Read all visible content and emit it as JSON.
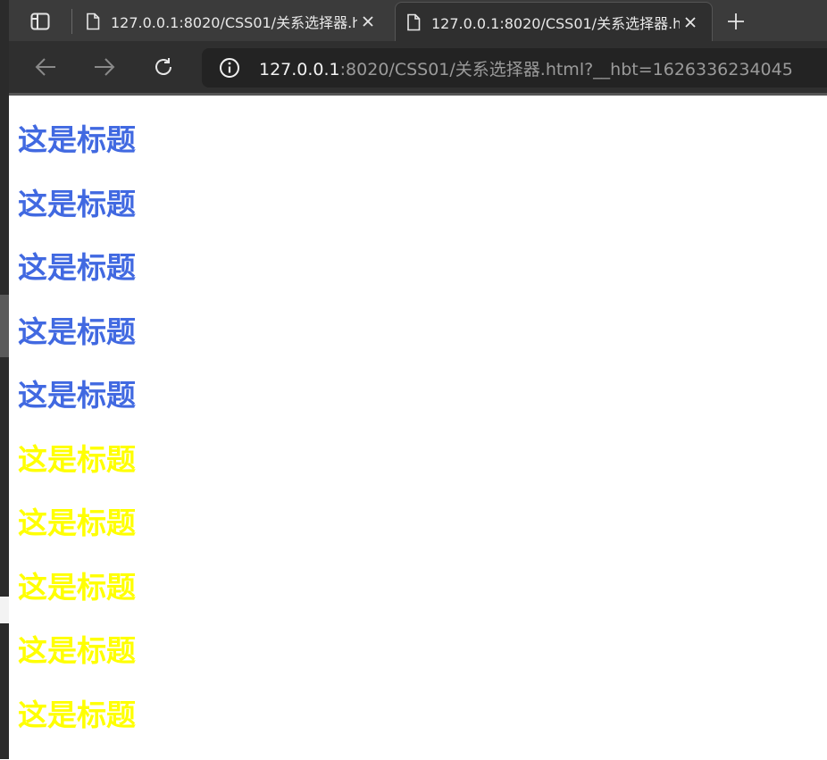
{
  "browser": {
    "tabs": [
      {
        "title": "127.0.0.1:8020/CSS01/关系选择器.html?__hbt=1626336234045",
        "active": false
      },
      {
        "title": "127.0.0.1:8020/CSS01/关系选择器.html?__hbt=1626336234045",
        "active": true
      }
    ],
    "address": {
      "host": "127.0.0.1",
      "path": ":8020/CSS01/关系选择器.html?__hbt=1626336234045"
    },
    "icons": {
      "tab_actions": "tab-actions-icon",
      "page": "page-icon",
      "close": "close-icon",
      "new_tab": "plus-icon",
      "back": "back-arrow-icon",
      "forward": "forward-arrow-icon",
      "reload": "reload-icon",
      "info": "info-icon"
    }
  },
  "page": {
    "headings": [
      {
        "text": "这是标题",
        "color": "#4169e1"
      },
      {
        "text": "这是标题",
        "color": "#4169e1"
      },
      {
        "text": "这是标题",
        "color": "#4169e1"
      },
      {
        "text": "这是标题",
        "color": "#4169e1"
      },
      {
        "text": "这是标题",
        "color": "#4169e1"
      },
      {
        "text": "这是标题",
        "color": "#ffff00"
      },
      {
        "text": "这是标题",
        "color": "#ffff00"
      },
      {
        "text": "这是标题",
        "color": "#ffff00"
      },
      {
        "text": "这是标题",
        "color": "#ffff00"
      },
      {
        "text": "这是标题",
        "color": "#ffff00"
      }
    ]
  },
  "colors": {
    "tabstrip": "#3b3b3b",
    "toolbar": "#2f2f2f",
    "heading_blue": "#4169e1",
    "heading_yellow": "#ffff00"
  }
}
